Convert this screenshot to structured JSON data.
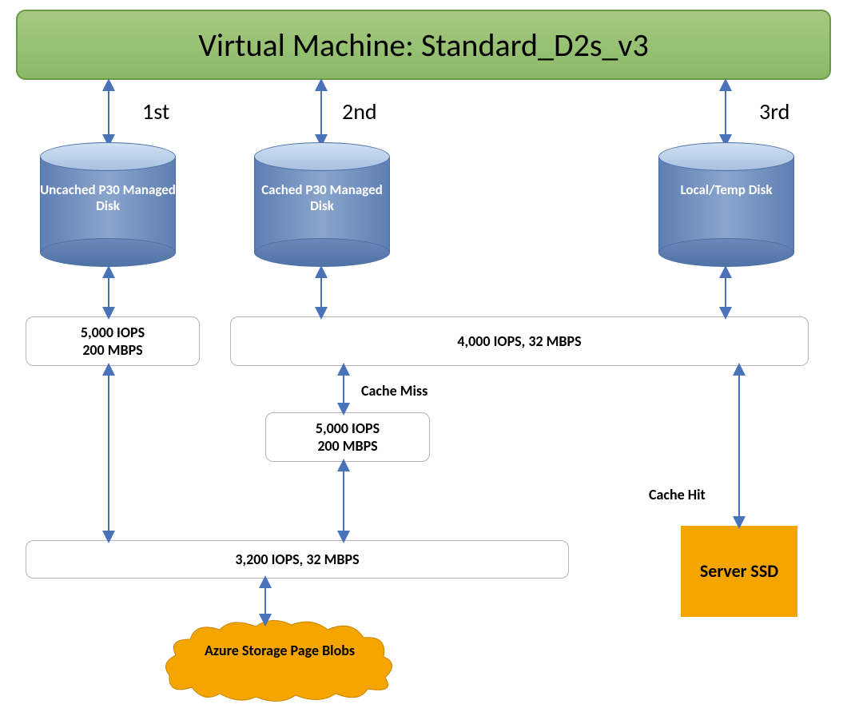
{
  "vm": {
    "title": "Virtual Machine: Standard_D2s_v3"
  },
  "ord": {
    "first": "1st",
    "second": "2nd",
    "third": "3rd"
  },
  "disks": {
    "uncached": "Uncached P30 Managed Disk",
    "cached": "Cached P30 Managed Disk",
    "local": "Local/Temp Disk"
  },
  "metrics": {
    "uncached_limit": "5,000 IOPS\n200 MBPS",
    "cached_limit": "4,000 IOPS, 32 MBPS",
    "cache_miss_limit": "5,000 IOPS\n200 MBPS",
    "combined_limit": "3,200 IOPS, 32 MBPS"
  },
  "labels": {
    "cache_miss": "Cache Miss",
    "cache_hit": "Cache Hit"
  },
  "server_ssd": "Server SSD",
  "azure_blobs": "Azure Storage Page Blobs"
}
